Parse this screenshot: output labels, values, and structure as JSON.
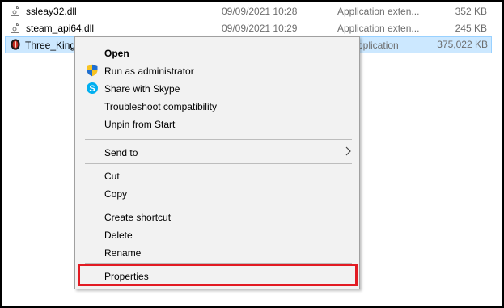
{
  "files": [
    {
      "name": "ssleay32.dll",
      "date": "09/09/2021 10:28",
      "type": "Application exten...",
      "size": "352 KB",
      "icon": "dll-file-icon"
    },
    {
      "name": "steam_api64.dll",
      "date": "09/09/2021 10:29",
      "type": "Application exten...",
      "size": "245 KB",
      "icon": "dll-file-icon"
    },
    {
      "name": "Three_Kingd",
      "date": "",
      "type": "pplication",
      "size": "375,022 KB",
      "icon": "app-exe-icon"
    }
  ],
  "menu": {
    "open": "Open",
    "run_as_admin": "Run as administrator",
    "share_skype": "Share with Skype",
    "troubleshoot": "Troubleshoot compatibility",
    "unpin": "Unpin from Start",
    "send_to": "Send to",
    "cut": "Cut",
    "copy": "Copy",
    "create_shortcut": "Create shortcut",
    "delete": "Delete",
    "rename": "Rename",
    "properties": "Properties"
  },
  "colors": {
    "selection_bg": "#cce8ff",
    "highlight_border": "#e21b23",
    "shield_blue": "#1f6fd1",
    "shield_yellow": "#f7c322",
    "skype_blue": "#00aff0"
  }
}
